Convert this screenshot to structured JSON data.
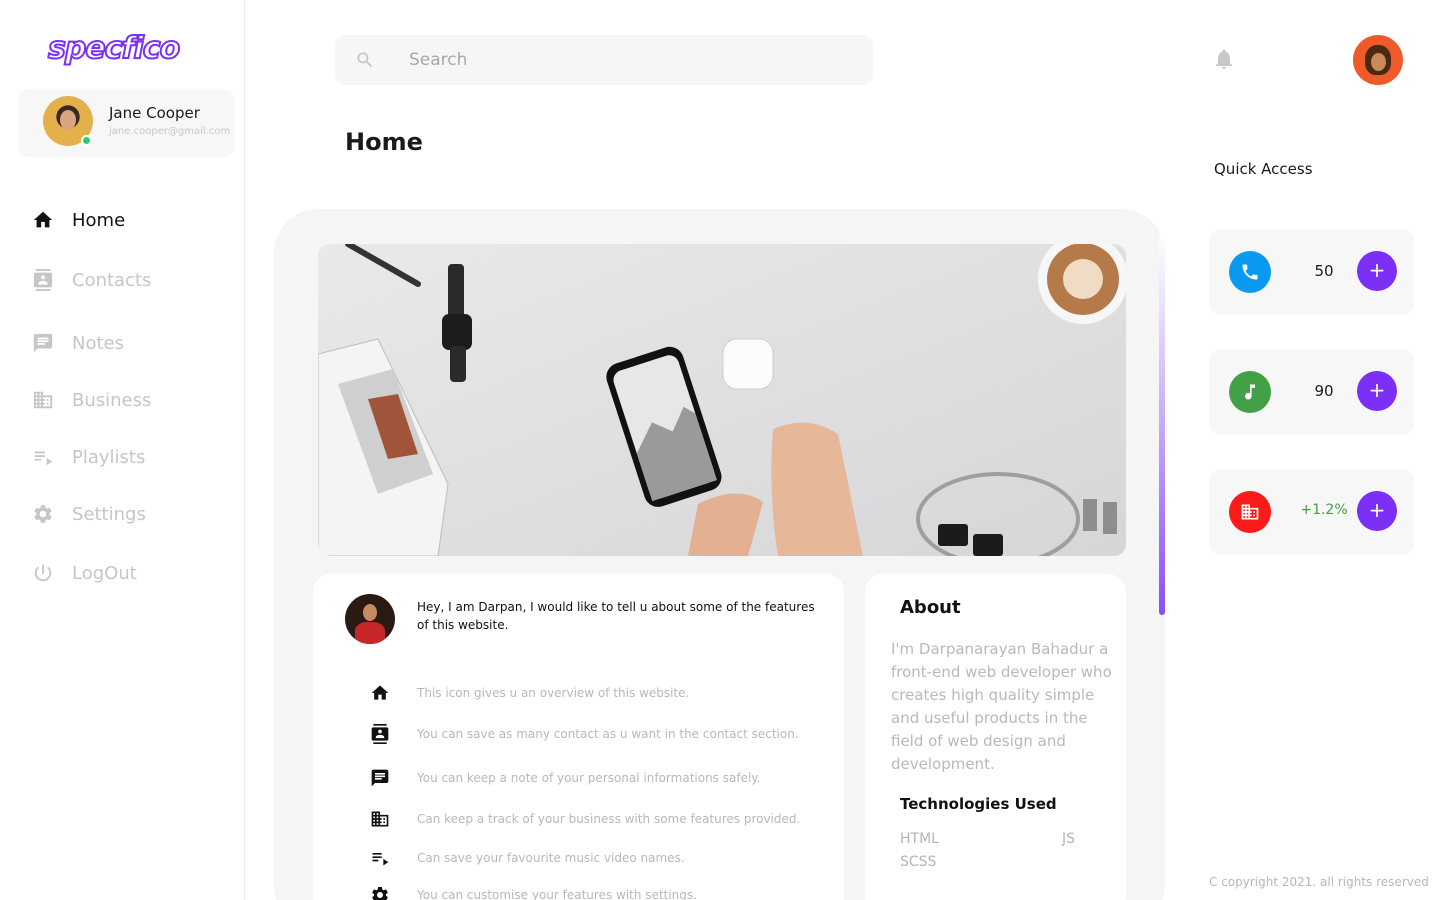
{
  "app": {
    "logo_text": "specfico"
  },
  "profile": {
    "name": "Jane Cooper",
    "email": "jane.cooper@gmail.com",
    "status": "online"
  },
  "sidebar": {
    "items": [
      {
        "label": "Home",
        "icon": "home-icon",
        "active": true
      },
      {
        "label": "Contacts",
        "icon": "contacts-icon",
        "active": false
      },
      {
        "label": "Notes",
        "icon": "notes-icon",
        "active": false
      },
      {
        "label": "Business",
        "icon": "business-icon",
        "active": false
      },
      {
        "label": "Playlists",
        "icon": "playlist-icon",
        "active": false
      },
      {
        "label": "Settings",
        "icon": "gear-icon",
        "active": false
      },
      {
        "label": "LogOut",
        "icon": "power-icon",
        "active": false
      }
    ]
  },
  "search": {
    "placeholder": "Search",
    "value": ""
  },
  "header": {
    "page_title": "Home"
  },
  "intro": {
    "text": "Hey, I am Darpan, I would like to tell u about some of the features of this website.",
    "features": [
      {
        "icon": "home-icon",
        "text": "This icon gives u an overview of this website."
      },
      {
        "icon": "contacts-icon",
        "text": "You can save as many contact as u want in the contact section."
      },
      {
        "icon": "notes-icon",
        "text": "You can keep a note of your personal informations safely."
      },
      {
        "icon": "business-icon",
        "text": "Can keep  a track of your business with some features provided."
      },
      {
        "icon": "playlist-icon",
        "text": "Can save  your favourite music video names."
      },
      {
        "icon": "gear-icon",
        "text": "You can customise your features with settings."
      }
    ]
  },
  "about": {
    "title": "About",
    "text": "I'm Darpanarayan Bahadur a front-end web developer who creates high quality simple and useful products in the field of web design and development.",
    "tech_title": "Technologies Used",
    "technologies": [
      "HTML",
      "JS",
      "SCSS"
    ]
  },
  "quick_access": {
    "title": "Quick Access",
    "cards": [
      {
        "icon": "phone-icon",
        "icon_color": "#0a99f0",
        "value": "50",
        "value_color": "#1a1a1a",
        "add_label": "+"
      },
      {
        "icon": "music-icon",
        "icon_color": "#43a047",
        "value": "90",
        "value_color": "#1a1a1a",
        "add_label": "+"
      },
      {
        "icon": "business-icon",
        "icon_color": "#ff1a1a",
        "value": "+1.2%",
        "value_color": "#43a047",
        "add_label": "+"
      }
    ]
  },
  "footer": {
    "copyright": "C copyright 2021. all rights reserved"
  },
  "colors": {
    "accent": "#7b2ff7",
    "panel": "#f5f5f6",
    "muted_text": "#c6c6c6"
  }
}
